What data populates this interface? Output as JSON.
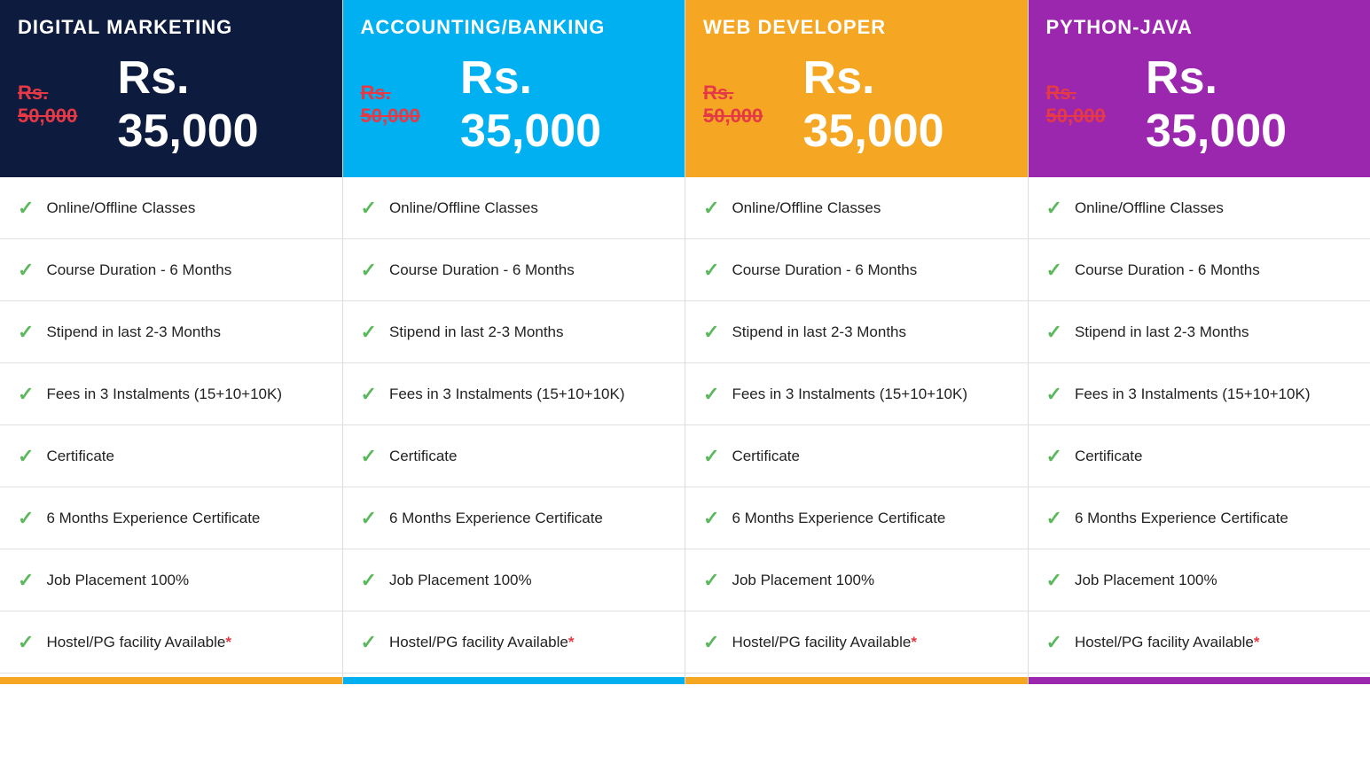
{
  "plans": [
    {
      "id": "digital-marketing",
      "headerClass": "dark-blue",
      "title": "DIGITAL MARKETING",
      "oldPrice": "Rs. 50,000",
      "newPrice": "Rs. 35,000",
      "barClass": "orange-bar",
      "features": [
        {
          "text": "Online/Offline Classes",
          "asterisk": false
        },
        {
          "text": "Course Duration - 6 Months",
          "asterisk": false
        },
        {
          "text": "Stipend in last 2-3 Months",
          "asterisk": false
        },
        {
          "text": "Fees in 3 Instalments (15+10+10K)",
          "asterisk": false
        },
        {
          "text": "Certificate",
          "asterisk": false
        },
        {
          "text": "6 Months Experience Certificate",
          "asterisk": false
        },
        {
          "text": "Job Placement 100%",
          "asterisk": false
        },
        {
          "text": "Hostel/PG facility Available",
          "asterisk": true
        }
      ]
    },
    {
      "id": "accounting-banking",
      "headerClass": "blue",
      "title": "ACCOUNTING/BANKING",
      "oldPrice": "Rs. 50,000",
      "newPrice": "Rs. 35,000",
      "barClass": "blue-bar",
      "features": [
        {
          "text": "Online/Offline Classes",
          "asterisk": false
        },
        {
          "text": "Course Duration - 6 Months",
          "asterisk": false
        },
        {
          "text": "Stipend in last 2-3 Months",
          "asterisk": false
        },
        {
          "text": "Fees in 3 Instalments (15+10+10K)",
          "asterisk": false
        },
        {
          "text": "Certificate",
          "asterisk": false
        },
        {
          "text": "6 Months Experience Certificate",
          "asterisk": false
        },
        {
          "text": "Job Placement 100%",
          "asterisk": false
        },
        {
          "text": "Hostel/PG facility Available",
          "asterisk": true
        }
      ]
    },
    {
      "id": "web-developer",
      "headerClass": "orange",
      "title": "WEB DEVELOPER",
      "oldPrice": "Rs. 50,000",
      "newPrice": "Rs. 35,000",
      "barClass": "orange2-bar",
      "features": [
        {
          "text": "Online/Offline Classes",
          "asterisk": false
        },
        {
          "text": "Course Duration - 6 Months",
          "asterisk": false
        },
        {
          "text": "Stipend in last 2-3 Months",
          "asterisk": false
        },
        {
          "text": "Fees in 3 Instalments (15+10+10K)",
          "asterisk": false
        },
        {
          "text": "Certificate",
          "asterisk": false
        },
        {
          "text": "6 Months Experience Certificate",
          "asterisk": false
        },
        {
          "text": "Job Placement 100%",
          "asterisk": false
        },
        {
          "text": "Hostel/PG facility Available",
          "asterisk": true
        }
      ]
    },
    {
      "id": "python-java",
      "headerClass": "purple",
      "title": "PYTHON-JAVA",
      "oldPrice": "Rs. 50,000",
      "newPrice": "Rs. 35,000",
      "barClass": "purple-bar",
      "features": [
        {
          "text": "Online/Offline Classes",
          "asterisk": false
        },
        {
          "text": "Course Duration - 6 Months",
          "asterisk": false
        },
        {
          "text": "Stipend in last 2-3 Months",
          "asterisk": false
        },
        {
          "text": "Fees in 3 Instalments (15+10+10K)",
          "asterisk": false
        },
        {
          "text": "Certificate",
          "asterisk": false
        },
        {
          "text": "6 Months Experience Certificate",
          "asterisk": false
        },
        {
          "text": "Job Placement 100%",
          "asterisk": false
        },
        {
          "text": "Hostel/PG facility Available",
          "asterisk": true
        }
      ]
    }
  ]
}
